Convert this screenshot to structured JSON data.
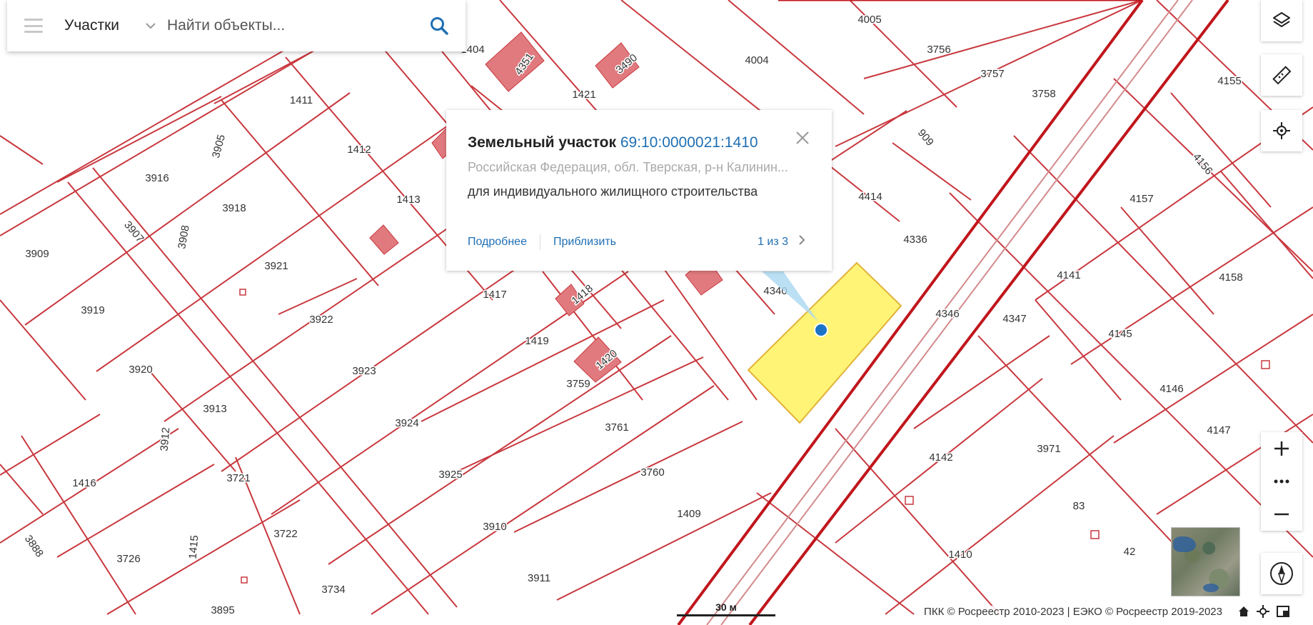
{
  "search": {
    "layer": "Участки",
    "placeholder": "Найти объекты..."
  },
  "popup": {
    "type": "Земельный участок",
    "cadastral_number": "69:10:0000021:1410",
    "address": "Российская Федерация, обл. Тверская, р-н Калинин...",
    "purpose": "для индивидуального жилищного строительства",
    "details_link": "Подробнее",
    "zoom_link": "Приблизить",
    "counter": "1 из 3"
  },
  "map": {
    "scale_label": "30 м",
    "attribution": "ПКК © Росреестр 2010-2023 | ЕЭКО © Росреестр 2019-2023",
    "selected_parcel": "1410",
    "parcel_labels": [
      "4005",
      "3756",
      "3757",
      "3758",
      "4004",
      "1404",
      "4351",
      "3490",
      "1421",
      "1411",
      "1412",
      "1413",
      "3905",
      "3916",
      "3918",
      "3907",
      "3908",
      "3909",
      "3919",
      "3920",
      "3921",
      "3922",
      "3923",
      "3924",
      "3925",
      "3910",
      "3911",
      "3912",
      "3913",
      "3721",
      "3722",
      "3734",
      "3726",
      "1415",
      "3895",
      "1416",
      "3888",
      "1417",
      "1418",
      "1419",
      "1420",
      "3759",
      "3761",
      "3760",
      "1409",
      "909",
      "4414",
      "4336",
      "4340",
      "4346",
      "4347",
      "4155",
      "4156",
      "4157",
      "4158",
      "4141",
      "4145",
      "4146",
      "4147",
      "4142",
      "3971",
      "83",
      "42",
      "1410"
    ]
  }
}
